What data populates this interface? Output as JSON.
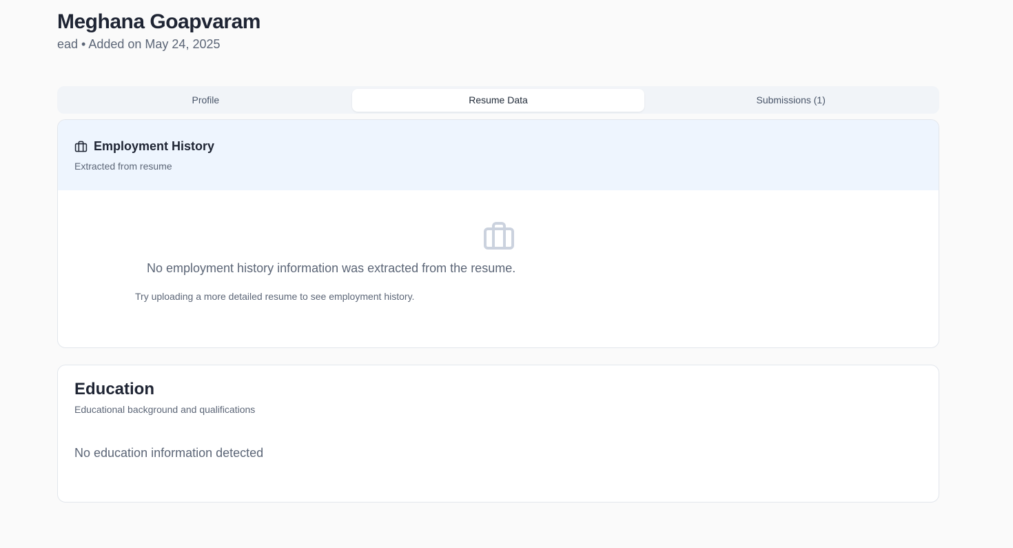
{
  "candidate": {
    "name": "Meghana Goapvaram",
    "meta": "ead • Added on May 24, 2025"
  },
  "tabs": [
    {
      "label": "Profile",
      "active": false
    },
    {
      "label": "Resume Data",
      "active": true
    },
    {
      "label": "Submissions (1)",
      "active": false
    }
  ],
  "employment": {
    "icon": "briefcase-icon",
    "title": "Employment History",
    "description": "Extracted from resume",
    "empty_icon": "briefcase-icon",
    "empty_message": "No employment history information was extracted from the resume.",
    "empty_hint": "Try uploading a more detailed resume to see employment history."
  },
  "education": {
    "title": "Education",
    "description": "Educational background and qualifications",
    "empty_message": "No education information detected"
  },
  "colors": {
    "page_bg": "#fafafa",
    "header_highlight": "#eef5fe",
    "muted_icon": "#cbd2de"
  }
}
